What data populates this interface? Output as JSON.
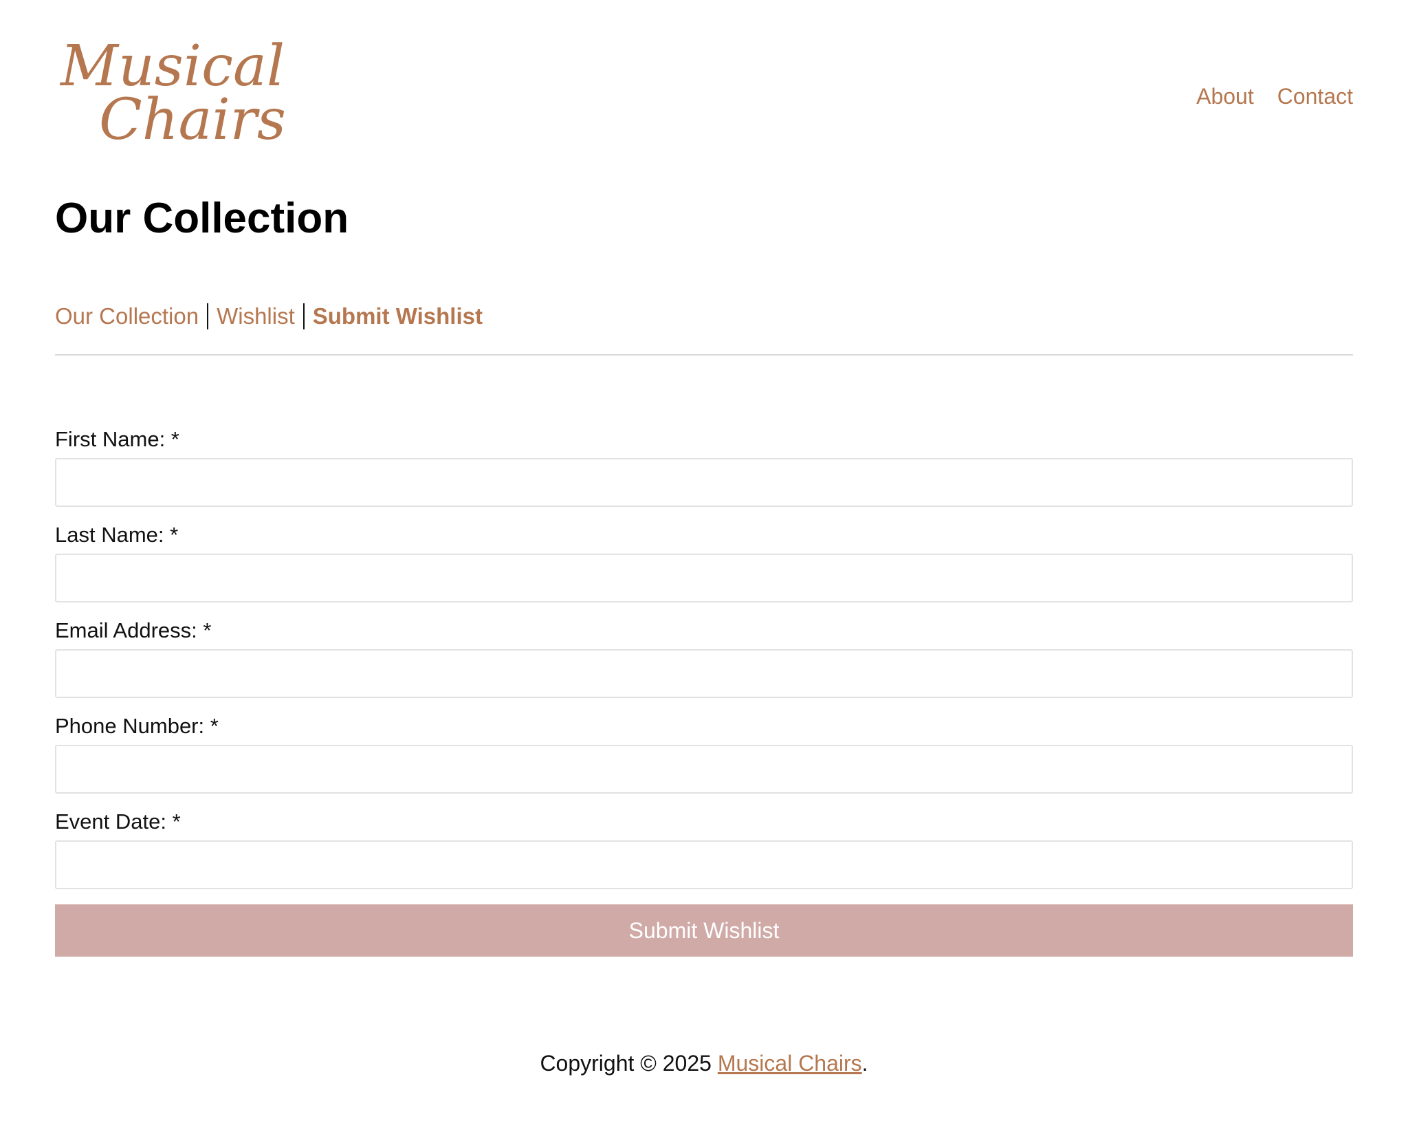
{
  "brand": {
    "logo_line1": "Musical",
    "logo_line2": "Chairs",
    "color": "#b5774f"
  },
  "topnav": {
    "about": "About",
    "contact": "Contact"
  },
  "page_title": "Our Collection",
  "breadcrumb": {
    "items": [
      {
        "label": "Our Collection",
        "active": false
      },
      {
        "label": "Wishlist",
        "active": false
      },
      {
        "label": "Submit Wishlist",
        "active": true
      }
    ]
  },
  "form": {
    "fields": [
      {
        "label": "First Name: *",
        "value": "",
        "placeholder": ""
      },
      {
        "label": "Last Name: *",
        "value": "",
        "placeholder": ""
      },
      {
        "label": "Email Address: *",
        "value": "",
        "placeholder": ""
      },
      {
        "label": "Phone Number: *",
        "value": "",
        "placeholder": ""
      },
      {
        "label": "Event Date: *",
        "value": "",
        "placeholder": ""
      }
    ],
    "submit_label": "Submit Wishlist",
    "submit_color": "#d0aaa7"
  },
  "footer": {
    "prefix": "Copyright © 2025 ",
    "link": "Musical Chairs",
    "suffix": "."
  }
}
